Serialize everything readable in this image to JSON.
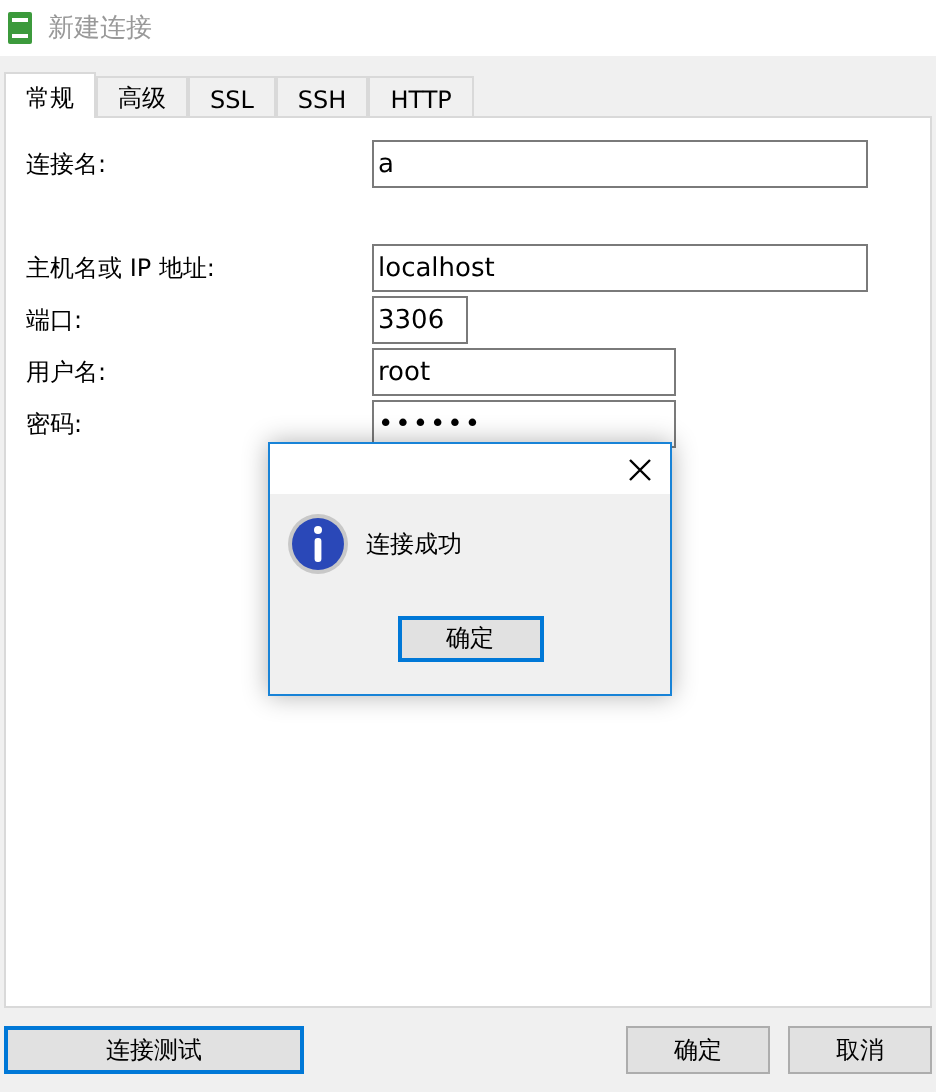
{
  "window": {
    "title": "新建连接"
  },
  "tabs": [
    {
      "label": "常规",
      "selected": true
    },
    {
      "label": "高级",
      "selected": false
    },
    {
      "label": "SSL",
      "selected": false
    },
    {
      "label": "SSH",
      "selected": false
    },
    {
      "label": "HTTP",
      "selected": false
    }
  ],
  "fields": [
    {
      "label": "连接名:",
      "value": "a"
    },
    {
      "label": "主机名或 IP 地址:",
      "value": "localhost"
    },
    {
      "label": "端口:",
      "value": "3306"
    },
    {
      "label": "用户名:",
      "value": "root"
    },
    {
      "label": "密码:",
      "value": "••••••"
    }
  ],
  "dialog": {
    "message": "连接成功",
    "button": "确定"
  },
  "buttons": [
    {
      "label": "连接测试",
      "focused": true
    },
    {
      "label": "确定",
      "focused": false
    },
    {
      "label": "取消",
      "focused": false
    }
  ]
}
